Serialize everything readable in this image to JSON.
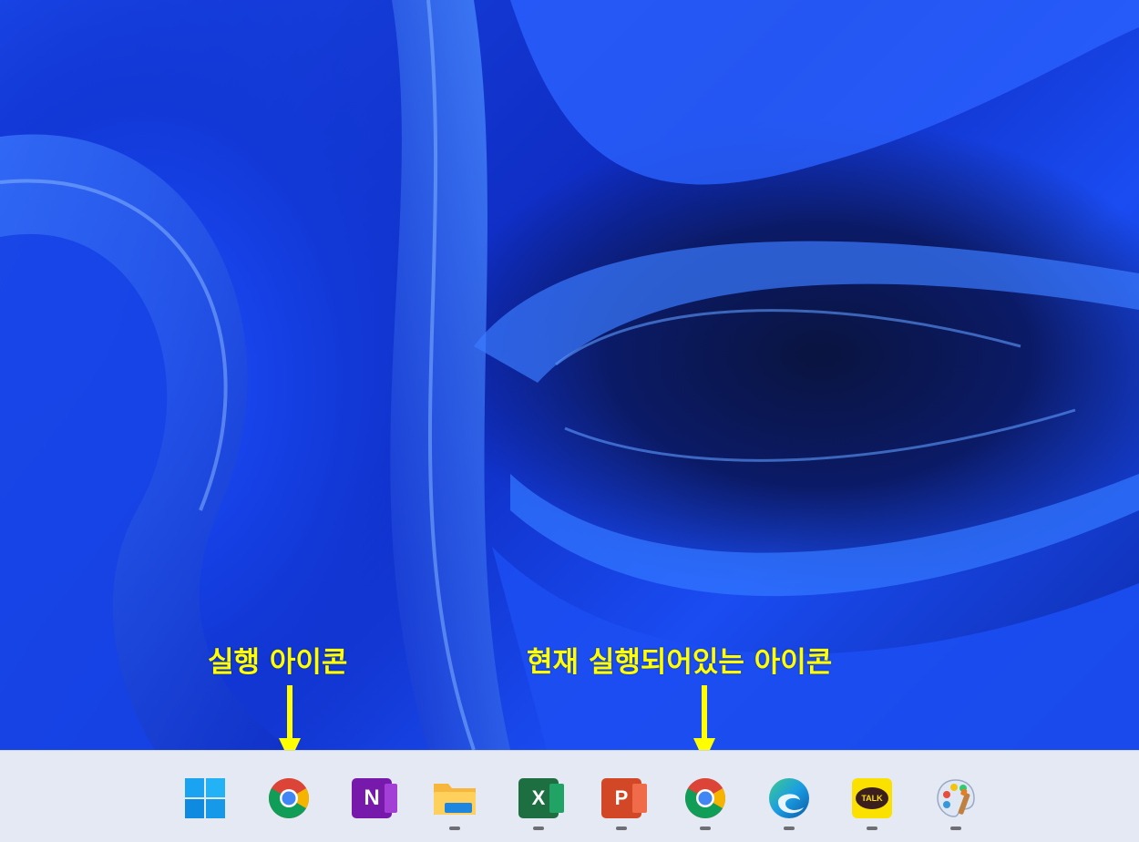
{
  "annotations": {
    "left_label": "실행 아이콘",
    "right_label": "현재 실행되어있는 아이콘",
    "color": "#ffff00"
  },
  "taskbar": {
    "icons": [
      {
        "name": "start",
        "icon": "windows-logo-icon",
        "running": false
      },
      {
        "name": "chrome-pinned",
        "icon": "chrome-icon",
        "running": false
      },
      {
        "name": "onenote",
        "icon": "onenote-icon",
        "glyph": "N",
        "running": false
      },
      {
        "name": "file-explorer",
        "icon": "folder-icon",
        "running": true
      },
      {
        "name": "excel",
        "icon": "excel-icon",
        "glyph": "X",
        "running": true
      },
      {
        "name": "powerpoint",
        "icon": "powerpoint-icon",
        "glyph": "P",
        "running": true
      },
      {
        "name": "chrome-running",
        "icon": "chrome-icon",
        "running": true
      },
      {
        "name": "edge",
        "icon": "edge-icon",
        "running": true
      },
      {
        "name": "kakaotalk",
        "icon": "kakaotalk-icon",
        "glyph": "TALK",
        "running": true
      },
      {
        "name": "paint",
        "icon": "paint-palette-icon",
        "running": true
      }
    ]
  }
}
